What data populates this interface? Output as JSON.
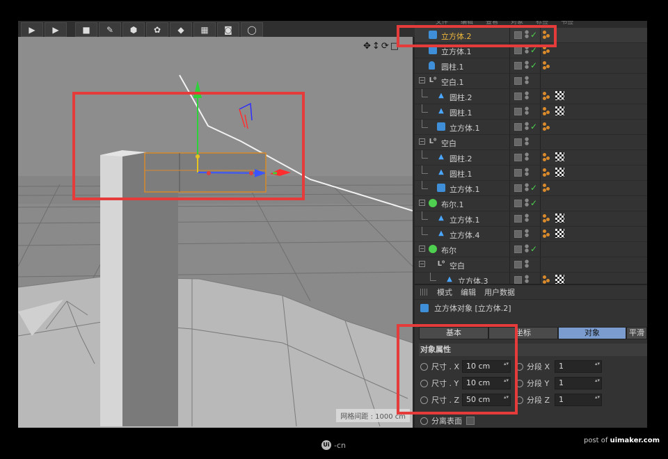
{
  "toolbar": {
    "buttons": [
      {
        "icon": "clapper-icon",
        "glyph": "▶"
      },
      {
        "icon": "clapper-icon",
        "glyph": "▶"
      },
      {
        "icon": "cube-icon",
        "glyph": "■"
      },
      {
        "icon": "spline-pen-icon",
        "glyph": "✎"
      },
      {
        "icon": "subdivision-icon",
        "glyph": "⬢"
      },
      {
        "icon": "cloner-icon",
        "glyph": "✿"
      },
      {
        "icon": "deformer-icon",
        "glyph": "◆"
      },
      {
        "icon": "floor-icon",
        "glyph": "▦"
      },
      {
        "icon": "camera-icon",
        "glyph": "◙"
      },
      {
        "icon": "light-icon",
        "glyph": "◯"
      }
    ]
  },
  "viewport": {
    "nav_icons": "✥↕⟳□",
    "grid_readout": "网格间距 : 1000 cm"
  },
  "object_manager": {
    "menu": [
      "文件",
      "编辑",
      "查看",
      "对象",
      "标签",
      "书签"
    ],
    "rows": [
      {
        "name": "立方体.2",
        "depth": 0,
        "icon": "cube-icon",
        "expand": "",
        "check": true,
        "tag_material": true,
        "tag_checker": false,
        "selected": true
      },
      {
        "name": "立方体.1",
        "depth": 0,
        "icon": "cube-icon",
        "expand": "",
        "check": true,
        "tag_material": true,
        "tag_checker": false
      },
      {
        "name": "圆柱.1",
        "depth": 0,
        "icon": "cylinder-icon",
        "expand": "",
        "check": true,
        "tag_material": true,
        "tag_checker": false
      },
      {
        "name": "空白.1",
        "depth": 0,
        "icon": "null-icon",
        "expand": "−",
        "check": false,
        "tag_material": false,
        "tag_checker": false
      },
      {
        "name": "圆柱.2",
        "depth": 1,
        "icon": "instance-icon",
        "expand": "",
        "check": false,
        "tag_material": true,
        "tag_checker": true
      },
      {
        "name": "圆柱.1",
        "depth": 1,
        "icon": "instance-icon",
        "expand": "",
        "check": false,
        "tag_material": true,
        "tag_checker": true
      },
      {
        "name": "立方体.1",
        "depth": 1,
        "icon": "cube-icon",
        "expand": "",
        "check": true,
        "tag_material": true,
        "tag_checker": false
      },
      {
        "name": "空白",
        "depth": 0,
        "icon": "null-icon",
        "expand": "−",
        "check": false,
        "tag_material": false,
        "tag_checker": false
      },
      {
        "name": "圆柱.2",
        "depth": 1,
        "icon": "instance-icon",
        "expand": "",
        "check": false,
        "tag_material": true,
        "tag_checker": true
      },
      {
        "name": "圆柱.1",
        "depth": 1,
        "icon": "instance-icon",
        "expand": "",
        "check": false,
        "tag_material": true,
        "tag_checker": true
      },
      {
        "name": "立方体.1",
        "depth": 1,
        "icon": "cube-icon",
        "expand": "",
        "check": true,
        "tag_material": true,
        "tag_checker": false
      },
      {
        "name": "布尔.1",
        "depth": 0,
        "icon": "boole-icon",
        "expand": "−",
        "check": true,
        "tag_material": false,
        "tag_checker": false
      },
      {
        "name": "立方体.1",
        "depth": 1,
        "icon": "instance-icon",
        "expand": "",
        "check": false,
        "tag_material": true,
        "tag_checker": true
      },
      {
        "name": "立方体.4",
        "depth": 1,
        "icon": "instance-icon",
        "expand": "",
        "check": false,
        "tag_material": true,
        "tag_checker": true
      },
      {
        "name": "布尔",
        "depth": 0,
        "icon": "boole-icon",
        "expand": "−",
        "check": true,
        "tag_material": false,
        "tag_checker": false
      },
      {
        "name": "空白",
        "depth": 1,
        "icon": "null-icon",
        "expand": "−",
        "check": false,
        "tag_material": false,
        "tag_checker": false
      },
      {
        "name": "立方体.3",
        "depth": 2,
        "icon": "instance-icon",
        "expand": "",
        "check": false,
        "tag_material": true,
        "tag_checker": true
      }
    ]
  },
  "attributes": {
    "menu": [
      "模式",
      "编辑",
      "用户数据"
    ],
    "object_title": "立方体对象 [立方体.2]",
    "tabs": [
      {
        "label": "基本",
        "active": false
      },
      {
        "label": "坐标",
        "active": false
      },
      {
        "label": "对象",
        "active": true
      },
      {
        "label": "平滑",
        "active": false
      }
    ],
    "section": "对象属性",
    "size_fields": [
      {
        "label": "尺寸 . X",
        "value": "10 cm"
      },
      {
        "label": "尺寸 . Y",
        "value": "10 cm"
      },
      {
        "label": "尺寸 . Z",
        "value": "50 cm"
      }
    ],
    "segment_fields": [
      {
        "label": "分段 X",
        "value": "1"
      },
      {
        "label": "分段 Y",
        "value": "1"
      },
      {
        "label": "分段 Z",
        "value": "1"
      }
    ],
    "separate_surfaces": "分离表面"
  },
  "footer": {
    "logo_mark": "Ui",
    "logo_text": "-cn",
    "credit_prefix": "post of",
    "credit_site": "uimaker.com"
  },
  "colors": {
    "highlight": "#e53b3b",
    "selected_text": "#f0b83a",
    "active_tab": "#7a9ccf",
    "check": "#4fd14f"
  }
}
